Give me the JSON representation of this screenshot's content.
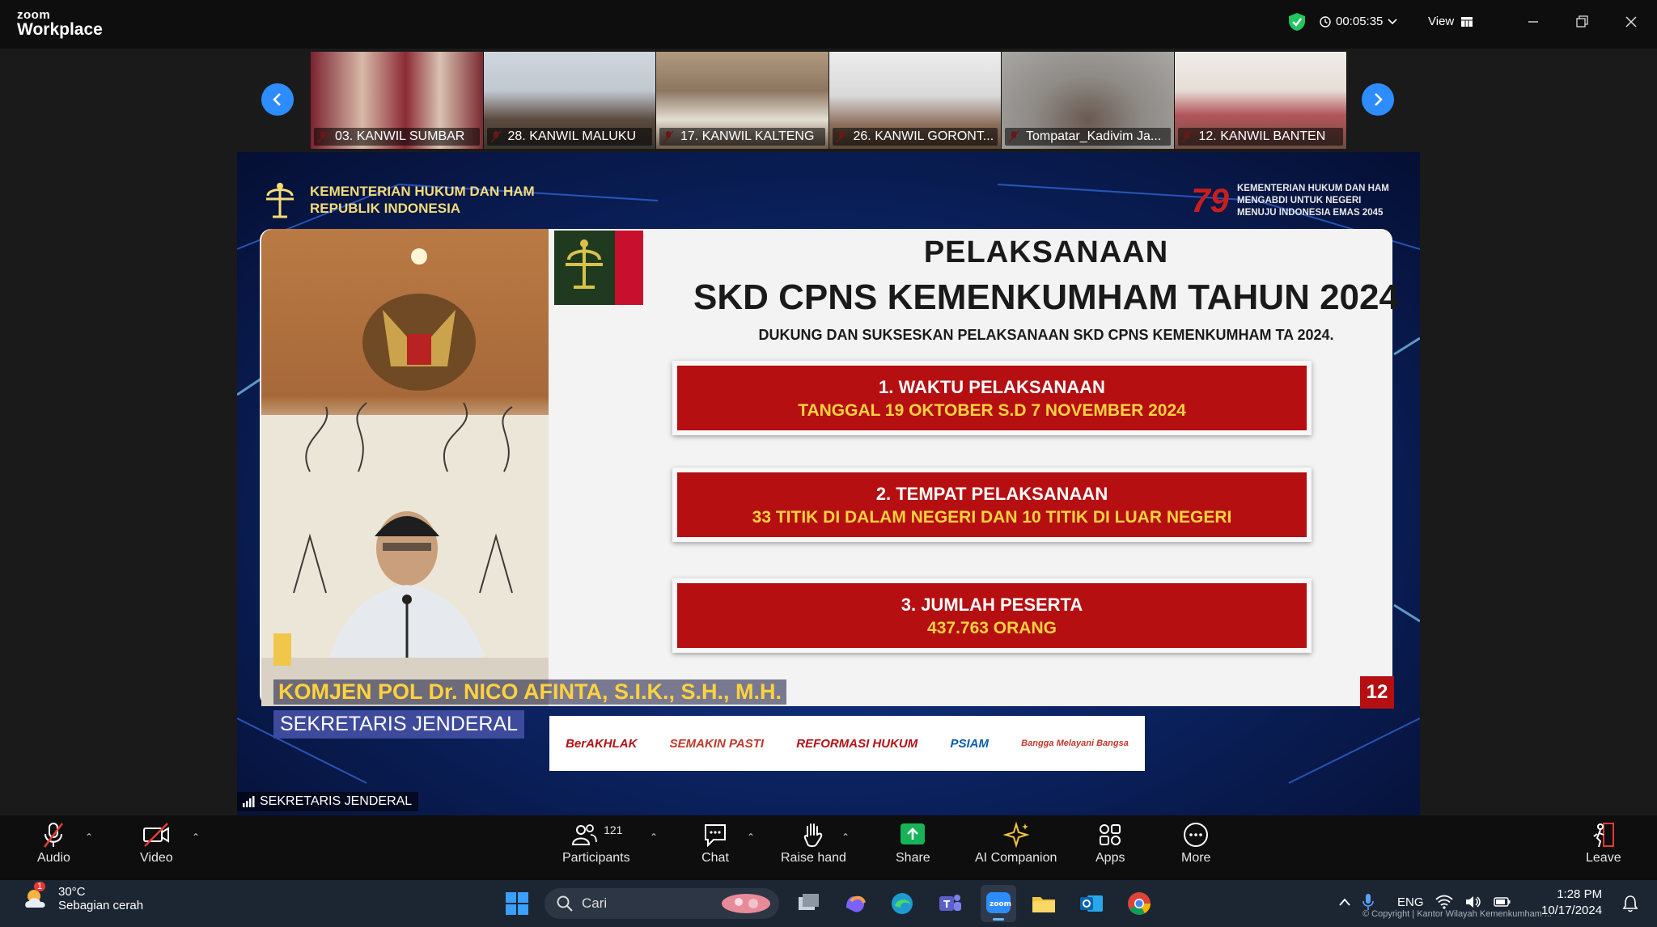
{
  "app": {
    "brand_top": "zoom",
    "brand_bottom": "Workplace"
  },
  "titlebar": {
    "timer": "00:05:35",
    "view_label": "View"
  },
  "gallery": {
    "thumbnails": [
      {
        "label": "03. KANWIL SUMBAR"
      },
      {
        "label": "28. KANWIL MALUKU"
      },
      {
        "label": "17. KANWIL KALTENG"
      },
      {
        "label": "26. KANWIL GORONT..."
      },
      {
        "label": "Tompatar_Kadivim Ja..."
      },
      {
        "label": "12. KANWIL BANTEN"
      }
    ]
  },
  "share": {
    "ministry": {
      "line1": "KEMENTERIAN HUKUM DAN HAM",
      "line2": "REPUBLIK INDONESIA"
    },
    "motto": {
      "logo": "79",
      "line1": "KEMENTERIAN HUKUM DAN HAM",
      "line2": "MENGABDI UNTUK NEGERI",
      "line3": "MENUJU INDONESIA EMAS 2045"
    },
    "slide": {
      "title1": "PELAKSANAAN",
      "title2": "SKD CPNS KEMENKUMHAM TAHUN 2024",
      "subtitle": "DUKUNG DAN SUKSESKAN PELAKSANAAN SKD CPNS KEMENKUMHAM TA 2024.",
      "items": [
        {
          "title": "1. WAKTU PELAKSANAAN",
          "detail": "TANGGAL 19 OKTOBER S.D 7 NOVEMBER 2024"
        },
        {
          "title": "2. TEMPAT PELAKSANAAN",
          "detail": "33 TITIK DI DALAM NEGERI DAN 10 TITIK DI LUAR NEGERI"
        },
        {
          "title": "3. JUMLAH PESERTA",
          "detail": "437.763 ORANG"
        }
      ],
      "page_number": "12"
    },
    "caption": {
      "name": "KOMJEN POL Dr. NICO AFINTA, S.I.K., S.H., M.H.",
      "role": "SEKRETARIS JENDERAL"
    },
    "logos": [
      "BerAKHLAK",
      "SEMAKIN PASTI",
      "REFORMASI HUKUM",
      "PSIAM",
      "Bangga Melayani Bangsa"
    ],
    "speaker_label": "SEKRETARIS JENDERAL"
  },
  "toolbar": {
    "audio": "Audio",
    "video": "Video",
    "participants": "Participants",
    "participants_count": "121",
    "chat": "Chat",
    "raise_hand": "Raise hand",
    "share": "Share",
    "ai_companion": "AI Companion",
    "apps": "Apps",
    "more": "More",
    "leave": "Leave"
  },
  "taskbar": {
    "weather_temp": "30°C",
    "weather_badge": "1",
    "weather_cond": "Sebagian cerah",
    "search_placeholder": "Cari",
    "lang": "ENG",
    "time": "1:28 PM",
    "date": "10/17/2024",
    "copyright": "© Copyright | Kantor Wilayah Kemenkumham ..."
  },
  "colors": {
    "accent": "#2d8cff",
    "slide_red": "#b50f12",
    "gold": "#ffd23e",
    "share_green": "#16b358"
  }
}
